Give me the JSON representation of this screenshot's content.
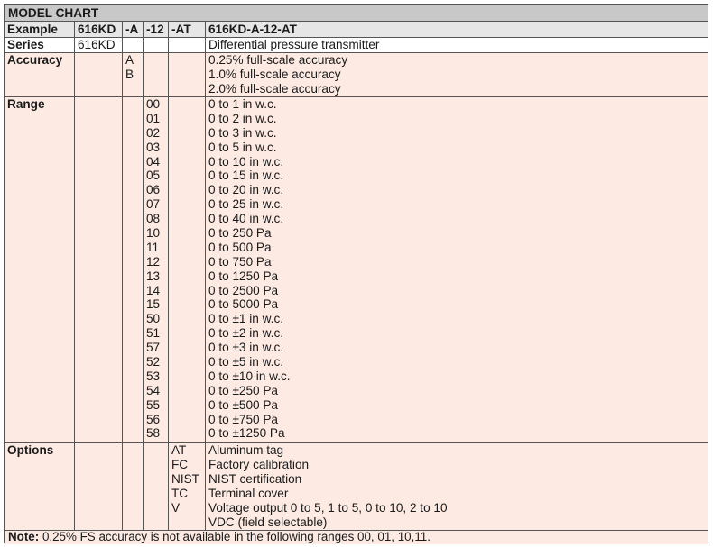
{
  "title": "MODEL CHART",
  "example": {
    "label": "Example",
    "series": "616KD",
    "accuracy": "-A",
    "range": "-12",
    "options": "-AT",
    "full": "616KD-A-12-AT"
  },
  "series": {
    "label": "Series",
    "code": "616KD",
    "desc": "Differential pressure transmitter"
  },
  "accuracy": {
    "label": "Accuracy",
    "codes": [
      "A",
      "B",
      ""
    ],
    "descs": [
      "0.25% full-scale accuracy",
      "1.0% full-scale accuracy",
      "2.0% full-scale accuracy"
    ]
  },
  "range": {
    "label": "Range",
    "codes": [
      "00",
      "01",
      "02",
      "03",
      "04",
      "05",
      "06",
      "07",
      "08",
      "10",
      "11",
      "12",
      "13",
      "14",
      "15",
      "50",
      "51",
      "57",
      "52",
      "53",
      "54",
      "55",
      "56",
      "58"
    ],
    "descs": [
      "0 to 1 in w.c.",
      "0 to 2 in w.c.",
      "0 to 3 in w.c.",
      "0 to 5 in w.c.",
      "0 to 10 in w.c.",
      "0 to 15 in w.c.",
      "0 to 20 in w.c.",
      "0 to 25 in w.c.",
      "0 to 40 in w.c.",
      "0 to 250 Pa",
      "0 to 500 Pa",
      "0 to 750 Pa",
      "0 to 1250 Pa",
      "0 to 2500 Pa",
      "0 to 5000 Pa",
      "0 to ±1 in w.c.",
      "0 to ±2 in w.c.",
      "0 to ±3 in w.c.",
      "0 to ±5 in w.c.",
      "0 to ±10 in w.c.",
      "0 to ±250 Pa",
      "0 to ±500 Pa",
      "0 to ±750 Pa",
      "0 to ±1250 Pa"
    ]
  },
  "options": {
    "label": "Options",
    "codes": [
      "AT",
      "FC",
      "NIST",
      "TC",
      "V",
      ""
    ],
    "descs": [
      "Aluminum tag",
      "Factory calibration",
      "NIST certification",
      "Terminal cover",
      "Voltage output 0 to 5, 1 to 5, 0 to 10, 2 to 10",
      "VDC (field selectable)"
    ]
  },
  "note": {
    "label": "Note:",
    "text": " 0.25% FS accuracy is not available in the following ranges 00, 01, 10,11."
  }
}
